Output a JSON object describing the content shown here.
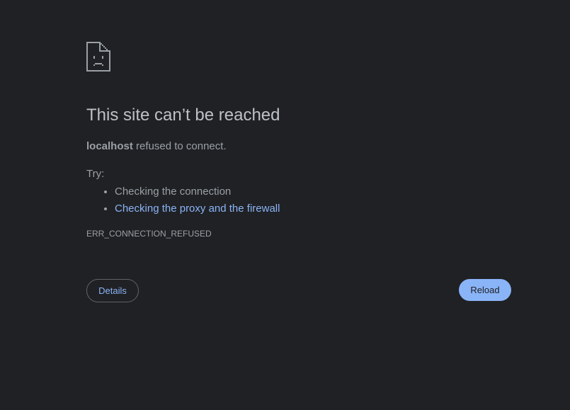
{
  "error_page": {
    "icon": "sad-document-icon",
    "title": "This site can’t be reached",
    "host": "localhost",
    "summary_rest": " refused to connect.",
    "try_label": "Try:",
    "suggestions": [
      {
        "label": "Checking the connection",
        "is_link": false
      },
      {
        "label": "Checking the proxy and the firewall",
        "is_link": true
      }
    ],
    "error_code": "ERR_CONNECTION_REFUSED"
  },
  "buttons": {
    "details_label": "Details",
    "reload_label": "Reload"
  },
  "colors": {
    "background": "#202124",
    "title_text": "#bdc1c6",
    "body_text": "#9aa0a6",
    "link": "#8ab4f8",
    "primary_button": "#8ab4f8",
    "outline_border": "#5f6368"
  }
}
